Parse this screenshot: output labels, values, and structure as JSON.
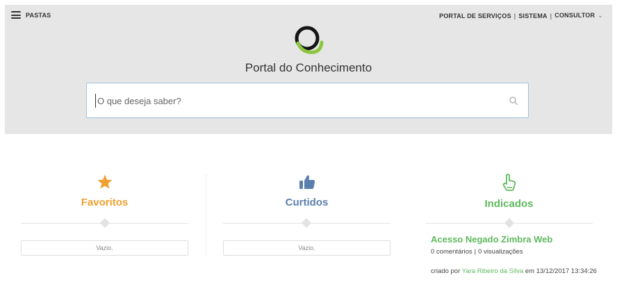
{
  "menu": {
    "label": "PASTAS",
    "icon": "hamburger-icon"
  },
  "topnav": {
    "portal": "PORTAL DE SERVIÇOS",
    "sistema": "SISTEMA",
    "consultor": "CONSULTOR",
    "separator": "|",
    "chevron": "⌄"
  },
  "title": "Portal do Conhecimento",
  "search": {
    "placeholder": "O que deseja saber?",
    "value": "",
    "icon": "search-icon"
  },
  "columns": {
    "favoritos": {
      "title": "Favoritos",
      "icon": "star-icon",
      "empty": "Vazio.",
      "color": "#f0a030"
    },
    "curtidos": {
      "title": "Curtidos",
      "icon": "thumbs-up-icon",
      "empty": "Vazio.",
      "color": "#5b7fad"
    },
    "indicados": {
      "title": "Indicados",
      "icon": "pointing-hand-icon",
      "color": "#5fb85f",
      "article": {
        "title": "Acesso Negado Zimbra Web",
        "comments": "0 comentários",
        "views": "0 visualizações",
        "meta_sep": "|",
        "created_prefix": "criado por",
        "author": "Yara Ribeiro da Silva",
        "created_suffix": "em 13/12/2017 13:34:26"
      }
    }
  }
}
